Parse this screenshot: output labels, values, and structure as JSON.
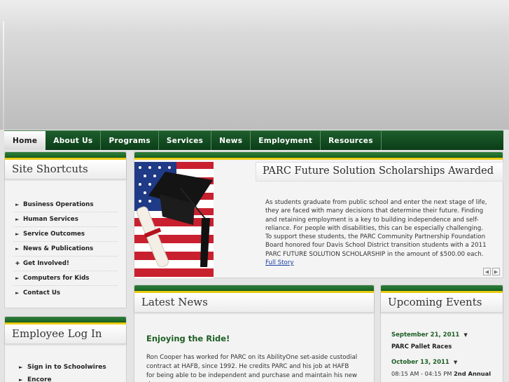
{
  "nav": {
    "items": [
      "Home",
      "About Us",
      "Programs",
      "Services",
      "News",
      "Employment",
      "Resources"
    ],
    "active": "Home"
  },
  "shortcuts": {
    "title": "Site Shortcuts",
    "items": [
      "Business Operations",
      "Human Services",
      "Service Outcomes",
      "News & Publications",
      "Get Involved!",
      "Computers for Kids",
      "Contact Us"
    ]
  },
  "login": {
    "title": "Employee Log In",
    "items": [
      "Sign in to Schoolwires",
      "Encore"
    ]
  },
  "feature": {
    "title": "PARC Future Solution Scholarships Awarded",
    "body": "As students graduate from public school and enter the next stage of life, they are faced with many decisions that determine their future. Finding and retaining employment is a key to building independence and self-reliance. For people with disabilities, this can be especially challenging. To support these students, the PARC Community Partnership Foundation Board honored four Davis School District transition students with a 2011 PARC FUTURE SOLUTION SCHOLARSHIP in the amount of $500.00 each.",
    "link": "Full Story",
    "image": "graduation-cap-flag-photo"
  },
  "news": {
    "title": "Latest News",
    "headline": "Enjoying the Ride!",
    "body": "Ron Cooper has worked for PARC on its AbilityOne set-aside custodial contract at HAFB, since 1992. He credits PARC and his job at HAFB for being able to be independent and purchase and maintain his new dream"
  },
  "events": {
    "title": "Upcoming Events",
    "items": [
      {
        "date": "September 21, 2011",
        "title": "PARC Pallet Races"
      },
      {
        "date": "October 13, 2011",
        "time": "08:15 AM - 04:15 PM",
        "title": "2nd Annual"
      }
    ]
  },
  "colors": {
    "nav_green": "#0b3d18",
    "accent_yellow": "#f2d42a",
    "headline_green": "#1d5e23",
    "link_blue": "#1a3ea8"
  }
}
